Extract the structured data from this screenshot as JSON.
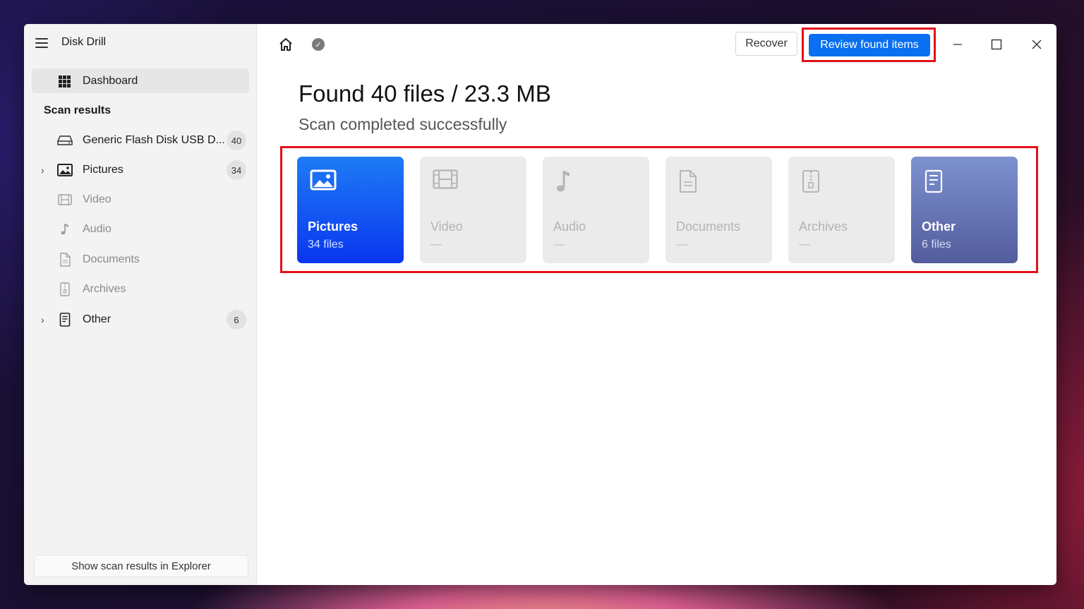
{
  "app": {
    "title": "Disk Drill"
  },
  "sidebar": {
    "dashboard_label": "Dashboard",
    "section_title": "Scan results",
    "items": [
      {
        "label": "Generic Flash Disk USB D...",
        "count": "40",
        "icon": "drive-icon",
        "expandable": false,
        "dim": false
      },
      {
        "label": "Pictures",
        "count": "34",
        "icon": "image-icon",
        "expandable": true,
        "dim": false
      },
      {
        "label": "Video",
        "count": "",
        "icon": "film-icon",
        "expandable": false,
        "dim": true
      },
      {
        "label": "Audio",
        "count": "",
        "icon": "music-note-icon",
        "expandable": false,
        "dim": true
      },
      {
        "label": "Documents",
        "count": "",
        "icon": "document-icon",
        "expandable": false,
        "dim": true
      },
      {
        "label": "Archives",
        "count": "",
        "icon": "archive-icon",
        "expandable": false,
        "dim": true
      },
      {
        "label": "Other",
        "count": "6",
        "icon": "other-file-icon",
        "expandable": true,
        "dim": false
      }
    ],
    "explorer_button": "Show scan results in Explorer"
  },
  "toolbar": {
    "recover_label": "Recover",
    "review_label": "Review found items"
  },
  "main": {
    "headline": "Found 40 files / 23.3 MB",
    "subline": "Scan completed successfully"
  },
  "tiles": [
    {
      "name": "Pictures",
      "sub": "34 files",
      "icon": "image-icon"
    },
    {
      "name": "Video",
      "sub": "—",
      "icon": "film-icon"
    },
    {
      "name": "Audio",
      "sub": "—",
      "icon": "music-note-icon"
    },
    {
      "name": "Documents",
      "sub": "—",
      "icon": "document-icon"
    },
    {
      "name": "Archives",
      "sub": "—",
      "icon": "archive-icon"
    },
    {
      "name": "Other",
      "sub": "6 files",
      "icon": "other-file-icon"
    }
  ],
  "colors": {
    "accent": "#0a6ff0",
    "highlight": "#e3101a",
    "pictures_tile": "#0a36f0",
    "other_tile": "#535c9c"
  }
}
